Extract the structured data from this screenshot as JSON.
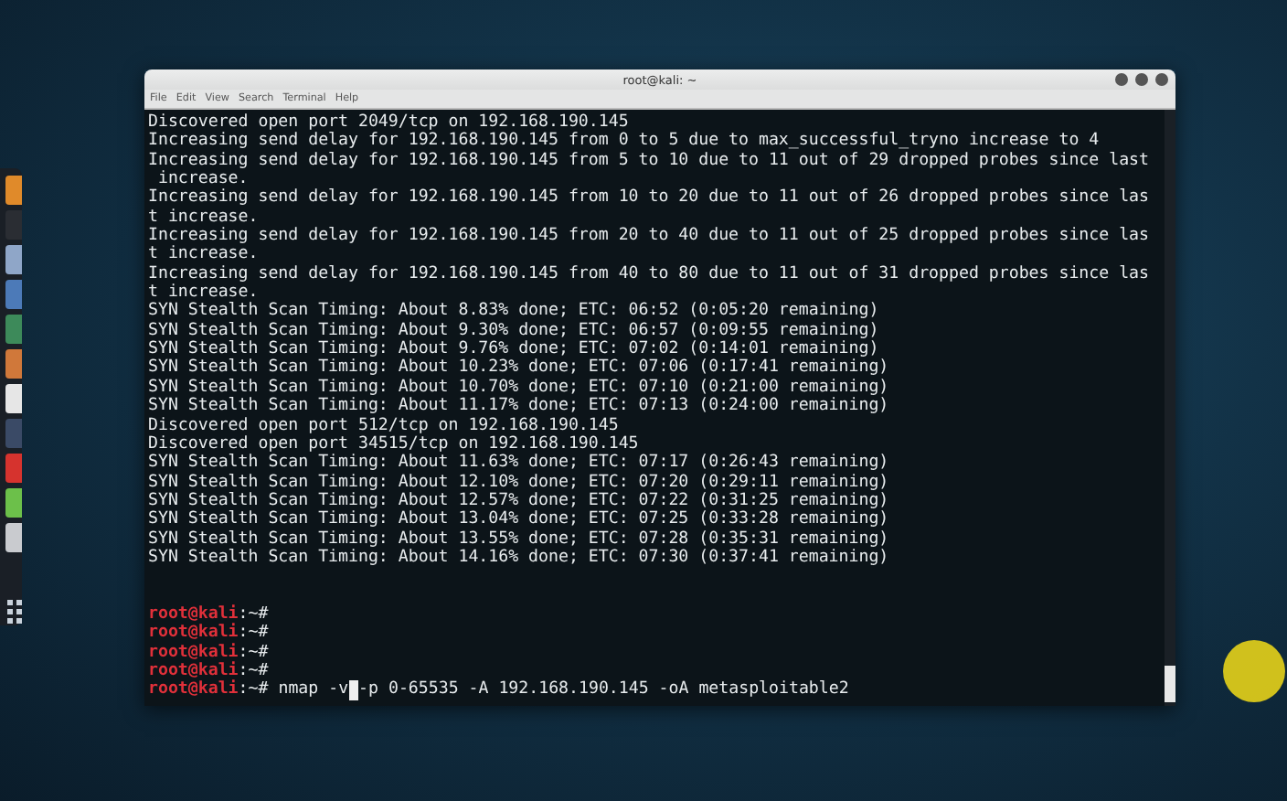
{
  "window": {
    "title": "root@kali: ~"
  },
  "menu": [
    "File",
    "Edit",
    "View",
    "Search",
    "Terminal",
    "Help"
  ],
  "lines": [
    {
      "kind": "output",
      "text": "Discovered open port 2049/tcp on 192.168.190.145"
    },
    {
      "kind": "output",
      "text": "Increasing send delay for 192.168.190.145 from 0 to 5 due to max_successful_tryno increase to 4"
    },
    {
      "kind": "output",
      "text": "Increasing send delay for 192.168.190.145 from 5 to 10 due to 11 out of 29 dropped probes since last"
    },
    {
      "kind": "output",
      "text": " increase."
    },
    {
      "kind": "output",
      "text": "Increasing send delay for 192.168.190.145 from 10 to 20 due to 11 out of 26 dropped probes since las"
    },
    {
      "kind": "output",
      "text": "t increase."
    },
    {
      "kind": "output",
      "text": "Increasing send delay for 192.168.190.145 from 20 to 40 due to 11 out of 25 dropped probes since las"
    },
    {
      "kind": "output",
      "text": "t increase."
    },
    {
      "kind": "output",
      "text": "Increasing send delay for 192.168.190.145 from 40 to 80 due to 11 out of 31 dropped probes since las"
    },
    {
      "kind": "output",
      "text": "t increase."
    },
    {
      "kind": "output",
      "text": "SYN Stealth Scan Timing: About 8.83% done; ETC: 06:52 (0:05:20 remaining)"
    },
    {
      "kind": "output",
      "text": "SYN Stealth Scan Timing: About 9.30% done; ETC: 06:57 (0:09:55 remaining)"
    },
    {
      "kind": "output",
      "text": "SYN Stealth Scan Timing: About 9.76% done; ETC: 07:02 (0:14:01 remaining)"
    },
    {
      "kind": "output",
      "text": "SYN Stealth Scan Timing: About 10.23% done; ETC: 07:06 (0:17:41 remaining)"
    },
    {
      "kind": "output",
      "text": "SYN Stealth Scan Timing: About 10.70% done; ETC: 07:10 (0:21:00 remaining)"
    },
    {
      "kind": "output",
      "text": "SYN Stealth Scan Timing: About 11.17% done; ETC: 07:13 (0:24:00 remaining)"
    },
    {
      "kind": "output",
      "text": "Discovered open port 512/tcp on 192.168.190.145"
    },
    {
      "kind": "output",
      "text": "Discovered open port 34515/tcp on 192.168.190.145"
    },
    {
      "kind": "output",
      "text": "SYN Stealth Scan Timing: About 11.63% done; ETC: 07:17 (0:26:43 remaining)"
    },
    {
      "kind": "output",
      "text": "SYN Stealth Scan Timing: About 12.10% done; ETC: 07:20 (0:29:11 remaining)"
    },
    {
      "kind": "output",
      "text": "SYN Stealth Scan Timing: About 12.57% done; ETC: 07:22 (0:31:25 remaining)"
    },
    {
      "kind": "output",
      "text": "SYN Stealth Scan Timing: About 13.04% done; ETC: 07:25 (0:33:28 remaining)"
    },
    {
      "kind": "output",
      "text": "SYN Stealth Scan Timing: About 13.55% done; ETC: 07:28 (0:35:31 remaining)"
    },
    {
      "kind": "output",
      "text": "SYN Stealth Scan Timing: About 14.16% done; ETC: 07:30 (0:37:41 remaining)"
    },
    {
      "kind": "blank"
    },
    {
      "kind": "blank"
    },
    {
      "kind": "prompt",
      "user": "root@kali",
      "path": ":~#"
    },
    {
      "kind": "prompt",
      "user": "root@kali",
      "path": ":~#"
    },
    {
      "kind": "prompt",
      "user": "root@kali",
      "path": ":~#"
    },
    {
      "kind": "prompt",
      "user": "root@kali",
      "path": ":~#"
    },
    {
      "kind": "input",
      "user": "root@kali",
      "path": ":~#",
      "before_cursor": "nmap -v",
      "after_cursor": "-p 0-65535 -A 192.168.190.145 -oA metasploitable2"
    }
  ],
  "dock": [
    {
      "color": "#e08a2a"
    },
    {
      "color": "#2a2d33"
    },
    {
      "color": "#8fa6c8"
    },
    {
      "color": "#4c7ab8"
    },
    {
      "color": "#3d8a5a"
    },
    {
      "color": "#d0783a"
    },
    {
      "color": "#e6e6e6"
    },
    {
      "color": "#3a4a66"
    },
    {
      "color": "#d6332e"
    },
    {
      "color": "#6cc04a"
    },
    {
      "color": "#c9cbcf"
    }
  ]
}
